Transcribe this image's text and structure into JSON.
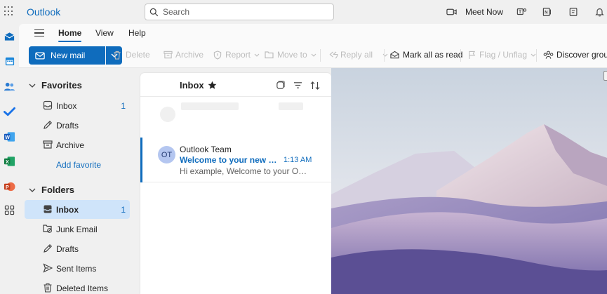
{
  "app": {
    "title": "Outlook"
  },
  "search": {
    "placeholder": "Search"
  },
  "header": {
    "meet_now": "Meet Now"
  },
  "ribbon": {
    "tabs": [
      "Home",
      "View",
      "Help"
    ],
    "new_mail": "New mail",
    "commands": {
      "delete": "Delete",
      "archive": "Archive",
      "report": "Report",
      "move_to": "Move to",
      "reply_all": "Reply all",
      "mark_all_read": "Mark all as read",
      "flag": "Flag / Unflag",
      "discover_groups": "Discover group"
    }
  },
  "sidebar": {
    "favorites": {
      "heading": "Favorites",
      "items": [
        {
          "label": "Inbox",
          "count": "1",
          "icon": "inbox-icon"
        },
        {
          "label": "Drafts",
          "icon": "pencil-icon"
        },
        {
          "label": "Archive",
          "icon": "archive-icon"
        }
      ],
      "add_favorite": "Add favorite"
    },
    "folders": {
      "heading": "Folders",
      "items": [
        {
          "label": "Inbox",
          "count": "1",
          "icon": "inbox-icon",
          "selected": true
        },
        {
          "label": "Junk Email",
          "icon": "junk-icon"
        },
        {
          "label": "Drafts",
          "icon": "pencil-icon"
        },
        {
          "label": "Sent Items",
          "icon": "send-icon"
        },
        {
          "label": "Deleted Items",
          "icon": "trash-icon"
        }
      ]
    }
  },
  "message_list": {
    "title": "Inbox",
    "messages": [
      {
        "initials": "OT",
        "sender": "Outlook Team",
        "subject": "Welcome to your new Ou...",
        "time": "1:13 AM",
        "preview": "Hi example, Welcome to your Outlo..."
      }
    ]
  },
  "colors": {
    "accent": "#0f6cbd",
    "selected_bg": "#cfe4fa",
    "avatar_bg": "#b4c6f0"
  }
}
